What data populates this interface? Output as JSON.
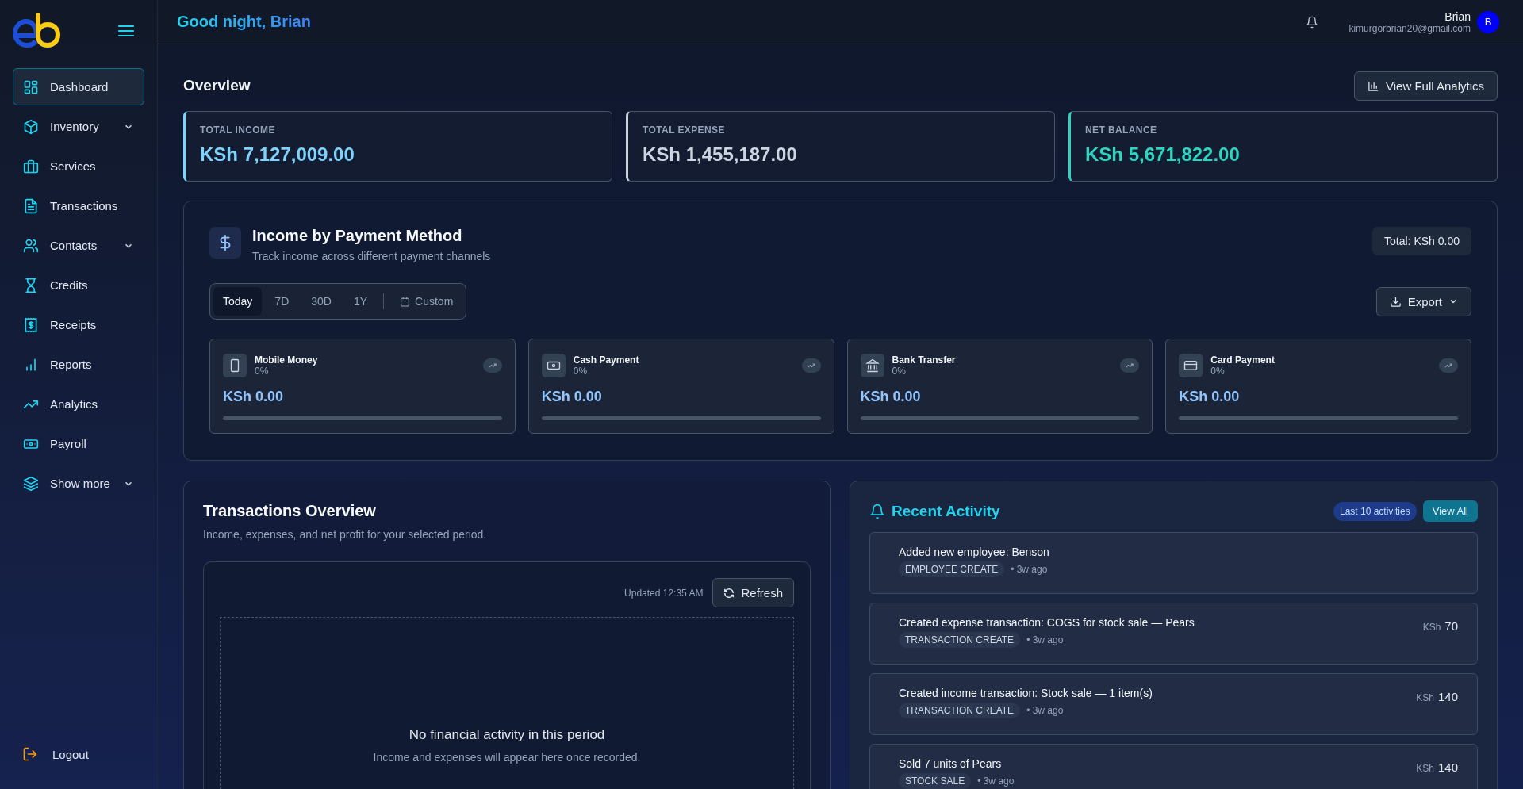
{
  "sidebar": {
    "items": [
      {
        "label": "Dashboard",
        "selected": true,
        "expandable": false
      },
      {
        "label": "Inventory",
        "selected": false,
        "expandable": true
      },
      {
        "label": "Services",
        "selected": false,
        "expandable": false
      },
      {
        "label": "Transactions",
        "selected": false,
        "expandable": false
      },
      {
        "label": "Contacts",
        "selected": false,
        "expandable": true
      },
      {
        "label": "Credits",
        "selected": false,
        "expandable": false
      },
      {
        "label": "Receipts",
        "selected": false,
        "expandable": false
      },
      {
        "label": "Reports",
        "selected": false,
        "expandable": false
      },
      {
        "label": "Analytics",
        "selected": false,
        "expandable": false
      },
      {
        "label": "Payroll",
        "selected": false,
        "expandable": false
      },
      {
        "label": "Show more",
        "selected": false,
        "expandable": true
      }
    ],
    "logout": "Logout"
  },
  "header": {
    "greeting": "Good night, Brian",
    "user_name": "Brian",
    "user_email": "kimurgorbrian20@gmail.com",
    "avatar": "B"
  },
  "overview": {
    "title": "Overview",
    "analytics_button": "View Full Analytics",
    "stats": [
      {
        "label": "TOTAL INCOME",
        "value": "KSh 7,127,009.00",
        "color": "#7dd3fc"
      },
      {
        "label": "TOTAL EXPENSE",
        "value": "KSh 1,455,187.00",
        "color": "#cbd5e1"
      },
      {
        "label": "NET BALANCE",
        "value": "KSh 5,671,822.00",
        "color": "#2dd4bf"
      }
    ]
  },
  "income_by_method": {
    "title": "Income by Payment Method",
    "subtitle": "Track income across different payment channels",
    "total": "Total: KSh 0.00",
    "ranges": [
      {
        "label": "Today",
        "selected": true
      },
      {
        "label": "7D",
        "selected": false
      },
      {
        "label": "30D",
        "selected": false
      },
      {
        "label": "1Y",
        "selected": false
      },
      {
        "label": "Custom",
        "selected": false
      }
    ],
    "export": "Export",
    "methods": [
      {
        "name": "Mobile Money",
        "share": "0%",
        "amount": "KSh 0.00",
        "level": 0
      },
      {
        "name": "Cash Payment",
        "share": "0%",
        "amount": "KSh 0.00",
        "level": 0
      },
      {
        "name": "Bank Transfer",
        "share": "0%",
        "amount": "KSh 0.00",
        "level": 0
      },
      {
        "name": "Card Payment",
        "share": "0%",
        "amount": "KSh 0.00",
        "level": 0
      }
    ]
  },
  "transactions_overview": {
    "title": "Transactions Overview",
    "subtitle": "Income, expenses, and net profit for your selected period.",
    "updated": "Updated 12:35 AM",
    "refresh": "Refresh",
    "empty_title": "No financial activity in this period",
    "empty_text": "Income and expenses will appear here once recorded."
  },
  "recent_activity": {
    "title": "Recent Activity",
    "badge": "Last 10 activities",
    "view_all": "View All",
    "items": [
      {
        "text": "Added new employee: Benson",
        "tag": "EMPLOYEE CREATE",
        "time": "• 3w ago"
      },
      {
        "text": "Created expense transaction: COGS for stock sale — Pears",
        "tag": "TRANSACTION CREATE",
        "time": "• 3w ago",
        "currency": "KSh",
        "amount": "70"
      },
      {
        "text": "Created income transaction: Stock sale — 1 item(s)",
        "tag": "TRANSACTION CREATE",
        "time": "• 3w ago",
        "currency": "KSh",
        "amount": "140"
      },
      {
        "text": "Sold 7 units of Pears",
        "tag": "STOCK SALE",
        "time": "• 3w ago",
        "currency": "KSh",
        "amount": "140"
      }
    ]
  }
}
